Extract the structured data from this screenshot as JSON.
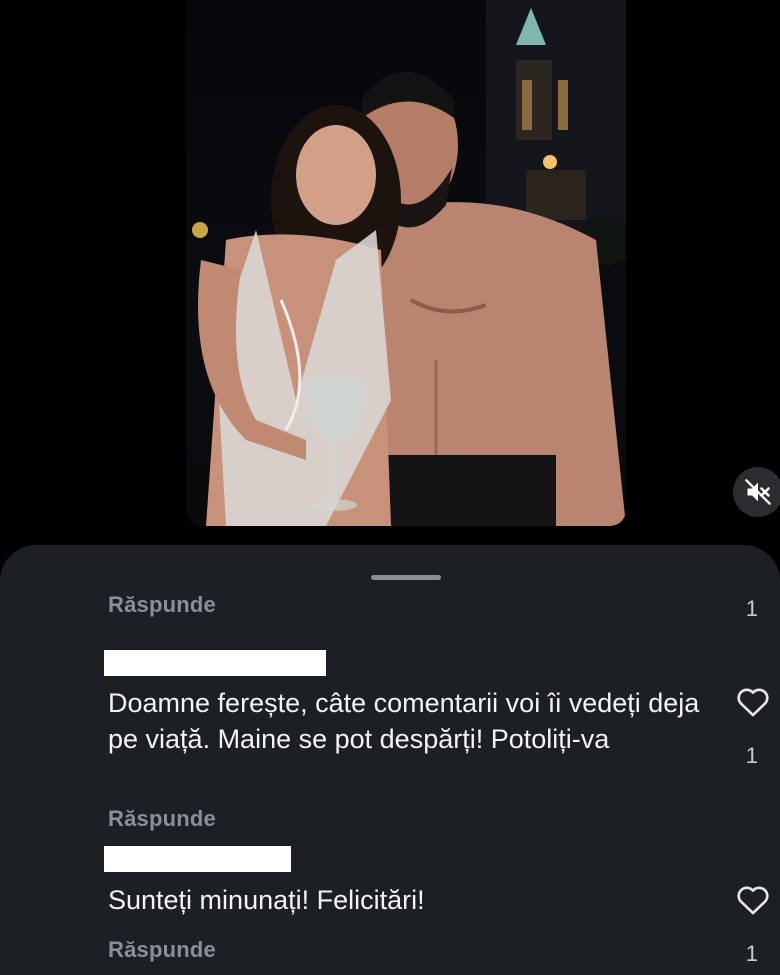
{
  "comments": {
    "reply_label": "Răspunde",
    "top_item": {
      "like_count": "1"
    },
    "items": [
      {
        "text": "Doamne ferește, câte comentarii voi îi vedeți deja pe viață. Maine se pot despărți! Potoliți-va",
        "like_count": "1",
        "reply_label": "Răspunde"
      },
      {
        "text": "Sunteți minunați! Felicitări!",
        "like_count": "1",
        "reply_label": "Răspunde"
      }
    ]
  },
  "icons": {
    "mute": "speaker-muted-icon",
    "like": "heart-outline-icon"
  },
  "colors": {
    "sheet_background": "#1c1f23",
    "reply_text": "#8b8f95",
    "comment_text": "#f2f3f5"
  }
}
